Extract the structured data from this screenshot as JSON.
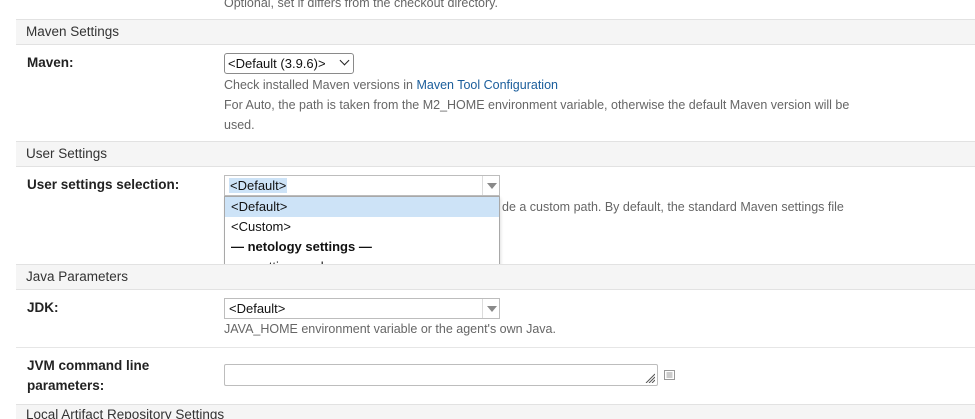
{
  "top_hint": "Optional, set if differs from the checkout directory.",
  "maven_section": {
    "header": "Maven Settings",
    "label": "Maven:",
    "selected": "<Default (3.9.6)>",
    "hint_prefix": "Check installed Maven versions in ",
    "hint_link": "Maven Tool Configuration",
    "hint2_line1": "For Auto, the path is taken from the M2_HOME environment variable, otherwise the default Maven version will be",
    "hint2_line2": "used."
  },
  "user_section": {
    "header": "User Settings",
    "label": "User settings selection:",
    "selected": "<Default>",
    "hint_visible": "de a custom path. By default, the standard Maven settings file",
    "dropdown": {
      "options": [
        "<Default>",
        "<Custom>"
      ],
      "group_label": "— netology settings —",
      "group_items": [
        "settings.xml"
      ]
    }
  },
  "java_section": {
    "header": "Java Parameters",
    "jdk_label": "JDK:",
    "jdk_selected": "<Default>",
    "jdk_hint": "JAVA_HOME environment variable or the agent's own Java.",
    "jvm_label_line1": "JVM command line",
    "jvm_label_line2": "parameters:",
    "jvm_value": ""
  },
  "local_repo_section": {
    "header": "Local Artifact Repository Settings"
  }
}
